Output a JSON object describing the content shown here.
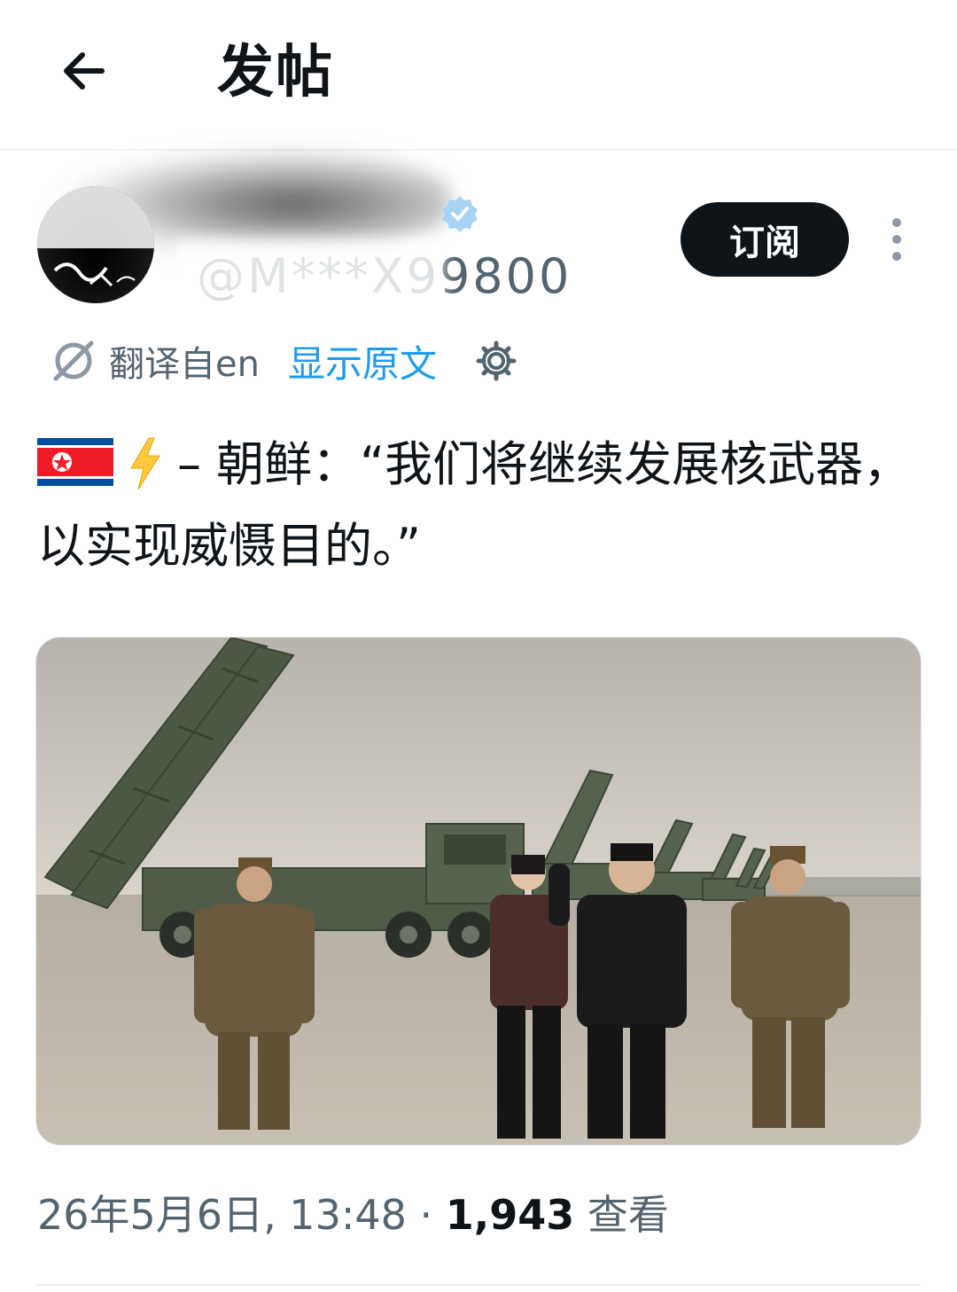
{
  "header": {
    "title": "发帖",
    "back_icon": "arrow-left-icon"
  },
  "author": {
    "handle": "@M***X99800",
    "verified": true,
    "subscribe_label": "订阅",
    "more_icon": "more-vertical-icon"
  },
  "translation": {
    "label": "翻译自en",
    "show_original": "显示原文",
    "translate_icon": "translate-icon",
    "settings_icon": "gear-icon"
  },
  "post": {
    "text": "– 朝鲜：“我们将继续发展核武器，以实现威慑目的。”",
    "flag_icon": "north-korea-flag-icon",
    "bolt_icon": "lightning-bolt-icon"
  },
  "media": {
    "image_icon": "photo-image"
  },
  "meta": {
    "timestamp": "26年5月6日, 13:48",
    "separator": " · ",
    "views": "1,943",
    "views_label": " 查看"
  },
  "colors": {
    "accent": "#1d9bf0",
    "text_primary": "#0f1419",
    "text_secondary": "#536471",
    "divider": "#eff3f4"
  }
}
